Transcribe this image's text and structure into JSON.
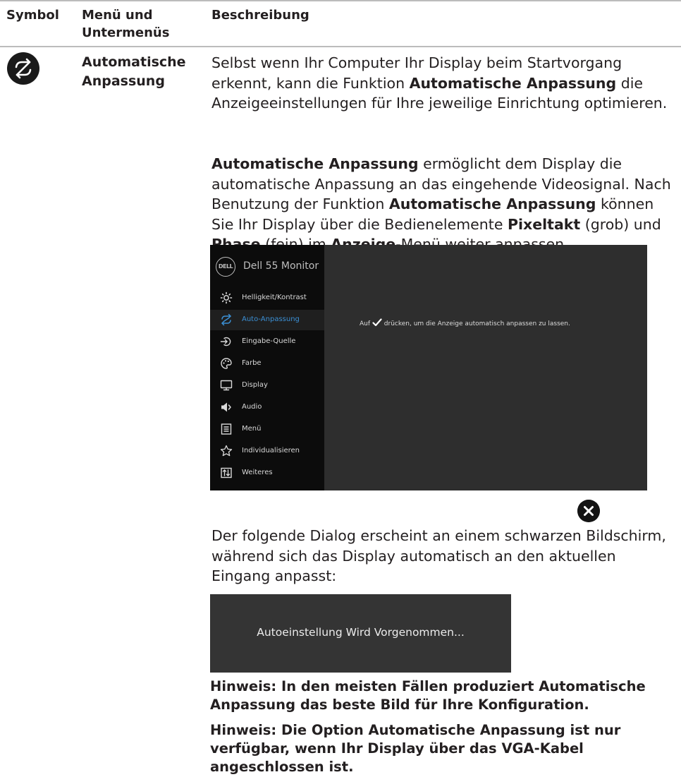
{
  "header": {
    "col_symbol": "Symbol",
    "col_menu": "Menü und Untermenüs",
    "col_desc": "Beschreibung"
  },
  "row": {
    "icon": "auto-adjust-icon",
    "menu_name": "Automatische Anpassung",
    "p1": {
      "t1": "Selbst wenn Ihr Computer Ihr Display beim Startvorgang erkennt, kann die Funktion ",
      "b1": "Automatische Anpassung",
      "t2": " die Anzeigeeinstellungen für Ihre jeweilige Einrichtung optimieren."
    },
    "p2": {
      "b1": "Automatische Anpassung",
      "t1": " ermöglicht dem Display die automatische Anpassung an das eingehende Videosignal. Nach Benutzung der Funktion ",
      "b2": "Automatische Anpassung",
      "t2": " können Sie Ihr Display über die Bedienelemente ",
      "b3": "Pixeltakt",
      "t3": " (grob) und ",
      "b4": "Phase",
      "t4": " (fein) im ",
      "b5": "Anzeige",
      "t5": "-Menü weiter anpassen."
    },
    "osd": {
      "logo_text": "DELL",
      "title": "Dell 55 Monitor",
      "items": [
        {
          "label": "Helligkeit/Kontrast",
          "icon": "brightness-icon"
        },
        {
          "label": "Auto-Anpassung",
          "icon": "auto-adjust-icon"
        },
        {
          "label": "Eingabe-Quelle",
          "icon": "input-source-icon"
        },
        {
          "label": "Farbe",
          "icon": "palette-icon"
        },
        {
          "label": "Display",
          "icon": "monitor-icon"
        },
        {
          "label": "Audio",
          "icon": "speaker-icon"
        },
        {
          "label": "Menü",
          "icon": "menu-list-icon"
        },
        {
          "label": "Individualisieren",
          "icon": "star-icon"
        },
        {
          "label": "Weiteres",
          "icon": "others-icon"
        }
      ],
      "active_item": "Auto-Anpassung",
      "active_color": "#3b8fd4",
      "message_before": "Auf",
      "message_after": "drücken, um die Anzeige automatisch anpassen zu lassen."
    },
    "close_icon": "close-icon",
    "p3": "Der folgende Dialog erscheint an einem schwarzen Bildschirm, während sich das Display automatisch an den aktuellen Eingang anpasst:",
    "dialog_text": "Autoeinstellung Wird Vorgenommen...",
    "note1": "Hinweis: In den meisten Fällen produziert Automatische Anpassung das beste Bild für Ihre Konfiguration.",
    "note2": "Hinweis: Die Option Automatische Anpassung ist nur verfügbar, wenn Ihr Display über das VGA-Kabel angeschlossen ist."
  }
}
